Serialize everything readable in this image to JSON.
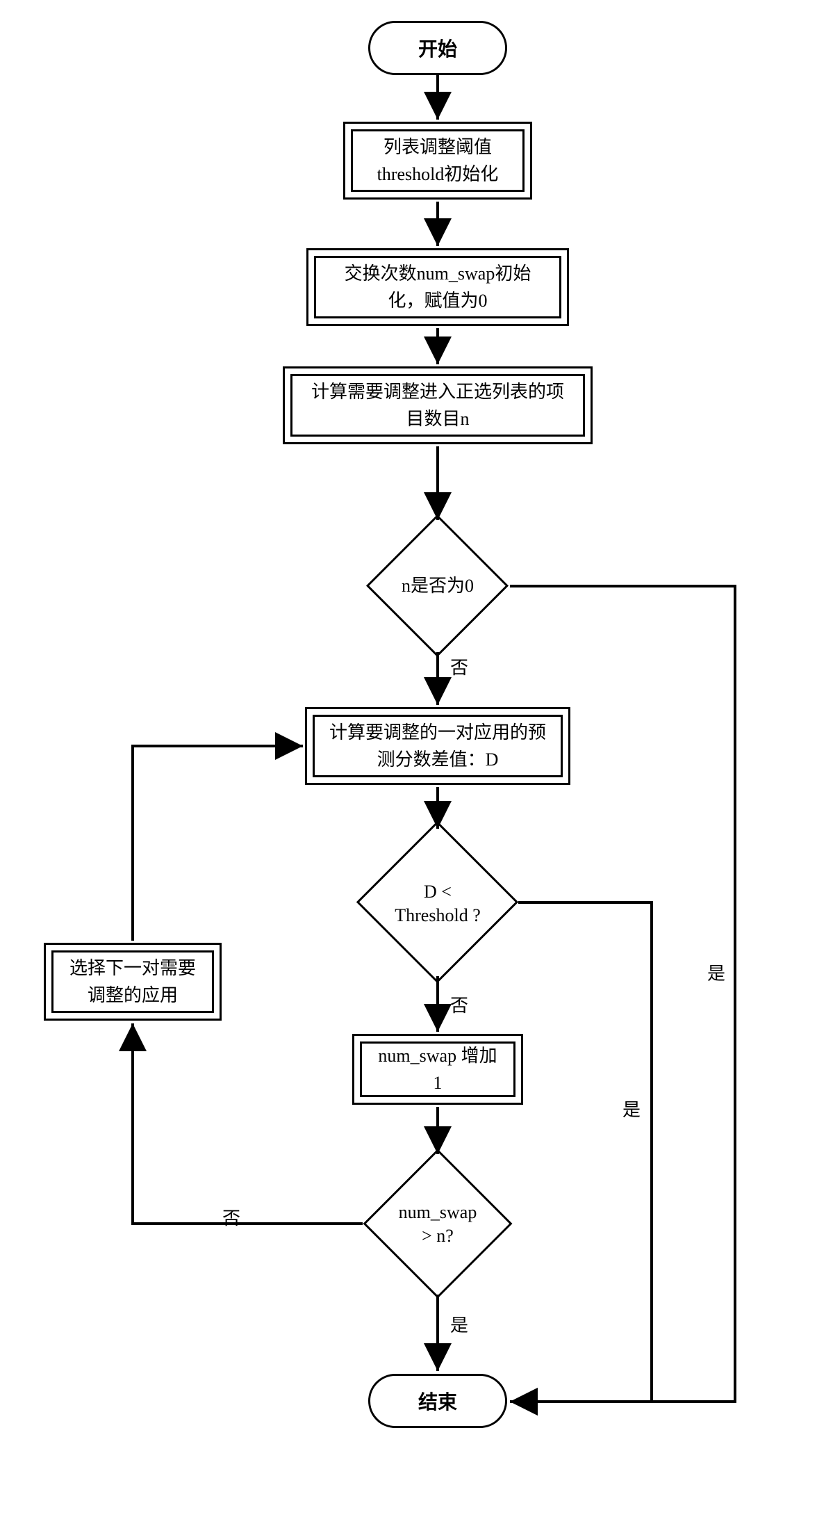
{
  "nodes": {
    "start": "开始",
    "init_threshold": "列表调整阈值\nthreshold初始化",
    "init_numswap": "交换次数num_swap初始\n化，赋值为0",
    "calc_n": "计算需要调整进入正选列表的项\n目数目n",
    "dec_n": "n是否为0",
    "calc_d": "计算要调整的一对应用的预\n测分数差值：D",
    "dec_d": "D <\nThreshold ?",
    "inc": "num_swap 增加\n1",
    "dec_swap": "num_swap\n> n?",
    "next_pair": "选择下一对需要\n调整的应用",
    "end": "结束"
  },
  "edges": {
    "yes": "是",
    "no": "否"
  }
}
